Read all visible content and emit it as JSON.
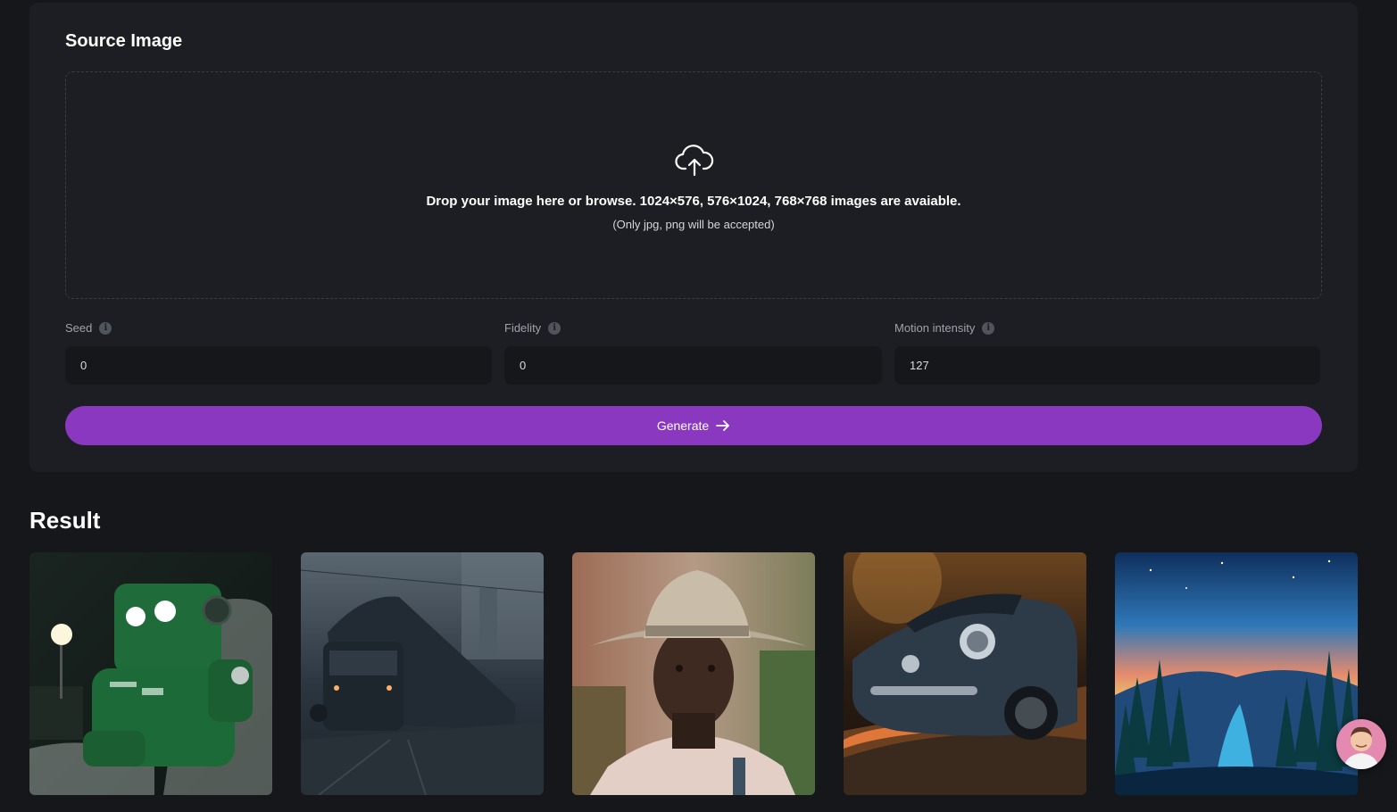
{
  "source_panel": {
    "title": "Source Image",
    "dropzone": {
      "main_text": "Drop your image here or browse. 1024×576, 576×1024, 768×768 images are avaiable.",
      "sub_text": "(Only jpg, png will be accepted)",
      "icon": "cloud-upload-icon"
    },
    "fields": [
      {
        "label": "Seed",
        "value": "0",
        "icon": "info-icon"
      },
      {
        "label": "Fidelity",
        "value": "0",
        "icon": "info-icon"
      },
      {
        "label": "Motion intensity",
        "value": "127",
        "icon": "info-icon"
      }
    ],
    "generate_button": {
      "label": "Generate",
      "icon": "arrow-right-icon",
      "color": "#8b38c0"
    }
  },
  "result": {
    "title": "Result",
    "thumbnails": [
      {
        "subject": "green robot",
        "icon": "thumbnail"
      },
      {
        "subject": "train in fog",
        "icon": "thumbnail"
      },
      {
        "subject": "man in cowboy hat",
        "icon": "thumbnail"
      },
      {
        "subject": "vintage car",
        "icon": "thumbnail"
      },
      {
        "subject": "forest landscape at sunset",
        "icon": "thumbnail"
      }
    ]
  },
  "support_avatar": {
    "icon": "avatar"
  }
}
